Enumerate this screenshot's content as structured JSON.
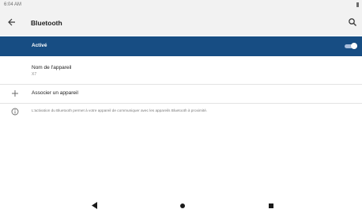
{
  "status_bar": {
    "time": "6:04 AM"
  },
  "app_bar": {
    "title": "Bluetooth",
    "back_icon": "arrow-left-icon",
    "search_icon": "search-icon"
  },
  "toggle": {
    "label": "Activé",
    "enabled": true,
    "accent_color": "#174d83"
  },
  "device_name": {
    "label": "Nom de l'appareil",
    "value": "X7"
  },
  "pair": {
    "label": "Associer un appareil",
    "icon": "plus-icon"
  },
  "info": {
    "icon": "info-icon",
    "text": "L'activation du Bluetooth permet à votre appareil de communiquer avec les appareils Bluetooth à proximité."
  },
  "nav_bar": {
    "back_icon": "triangle-back-icon",
    "home_icon": "circle-home-icon",
    "recent_icon": "square-recents-icon"
  }
}
